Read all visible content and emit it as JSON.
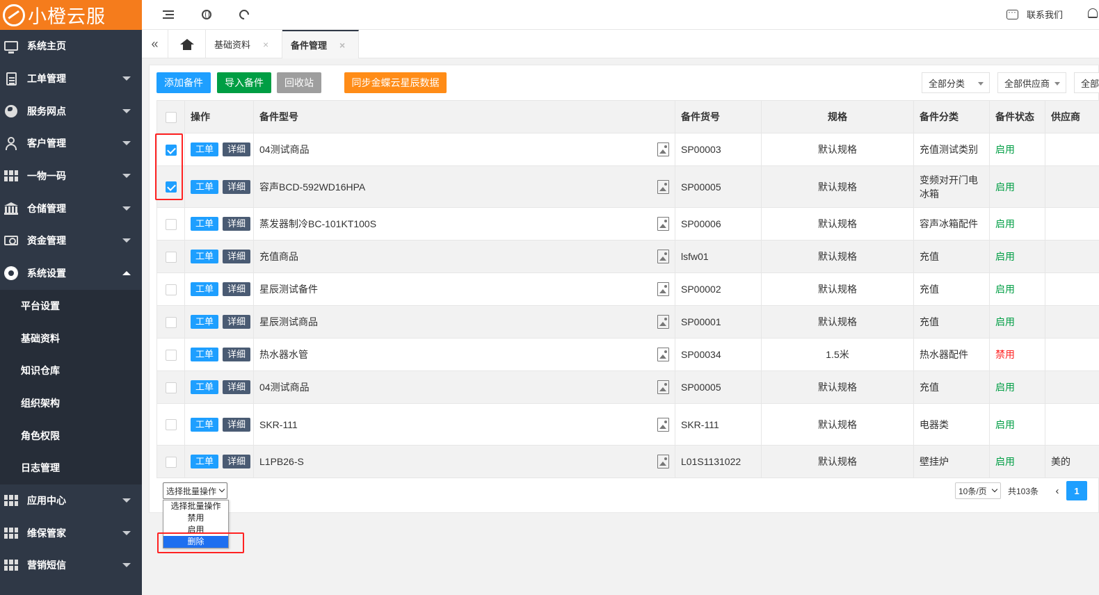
{
  "app": {
    "name": "小橙云服"
  },
  "sidebar": {
    "items": [
      {
        "label": "系统主页",
        "icon": "monitor-icon",
        "has_caret": false
      },
      {
        "label": "工单管理",
        "icon": "document-icon",
        "has_caret": true
      },
      {
        "label": "服务网点",
        "icon": "globe-icon",
        "has_caret": true
      },
      {
        "label": "客户管理",
        "icon": "user-icon",
        "has_caret": true
      },
      {
        "label": "一物一码",
        "icon": "grid-icon",
        "has_caret": true
      },
      {
        "label": "仓储管理",
        "icon": "bank-icon",
        "has_caret": true
      },
      {
        "label": "资金管理",
        "icon": "money-icon",
        "has_caret": true
      },
      {
        "label": "系统设置",
        "icon": "gear-icon",
        "has_caret": true,
        "expanded": true
      }
    ],
    "sub_items": [
      "平台设置",
      "基础资料",
      "知识仓库",
      "组织架构",
      "角色权限",
      "日志管理"
    ],
    "bottom_items": [
      {
        "label": "应用中心",
        "icon": "grid-icon"
      },
      {
        "label": "维保管家",
        "icon": "grid-icon"
      },
      {
        "label": "营销短信",
        "icon": "grid-icon"
      }
    ]
  },
  "topbar": {
    "contact": "联系我们"
  },
  "tabs": [
    {
      "label": "基础资料",
      "close": "×"
    },
    {
      "label": "备件管理",
      "close": "×",
      "active": true
    }
  ],
  "toolbar": {
    "add": "添加备件",
    "import": "导入备件",
    "recycle": "回收站",
    "sync": "同步金蝶云星辰数据",
    "filter_category": "全部分类",
    "filter_supplier": "全部供应商",
    "filter_more": "全部"
  },
  "table": {
    "columns": [
      "操作",
      "备件型号",
      "备件货号",
      "规格",
      "备件分类",
      "备件状态",
      "供应商"
    ],
    "action_wo": "工单",
    "action_detail": "详细",
    "rows": [
      {
        "checked": true,
        "model": "04测试商品",
        "sku": "SP00003",
        "spec": "默认规格",
        "category": "充值测试类别",
        "status": "启用",
        "supplier": ""
      },
      {
        "checked": true,
        "model": "容声BCD-592WD16HPA",
        "sku": "SP00005",
        "spec": "默认规格",
        "category": "变频对开门电冰箱",
        "status": "启用",
        "supplier": ""
      },
      {
        "checked": false,
        "model": "蒸发器制冷BC-101KT100S",
        "sku": "SP00006",
        "spec": "默认规格",
        "category": "容声冰箱配件",
        "status": "启用",
        "supplier": ""
      },
      {
        "checked": false,
        "model": "充值商品",
        "sku": "lsfw01",
        "spec": "默认规格",
        "category": "充值",
        "status": "启用",
        "supplier": ""
      },
      {
        "checked": false,
        "model": "星辰测试备件",
        "sku": "SP00002",
        "spec": "默认规格",
        "category": "充值",
        "status": "启用",
        "supplier": ""
      },
      {
        "checked": false,
        "model": "星辰测试商品",
        "sku": "SP00001",
        "spec": "默认规格",
        "category": "充值",
        "status": "启用",
        "supplier": ""
      },
      {
        "checked": false,
        "model": "热水器水管",
        "sku": "SP00034",
        "spec": "1.5米",
        "category": "热水器配件",
        "status": "禁用",
        "supplier": ""
      },
      {
        "checked": false,
        "model": "04测试商品",
        "sku": "SP00005",
        "spec": "默认规格",
        "category": "充值",
        "status": "启用",
        "supplier": ""
      },
      {
        "checked": false,
        "model": "SKR-111",
        "sku": "SKR-111",
        "spec": "默认规格",
        "category": "电器类",
        "status": "启用",
        "supplier": ""
      },
      {
        "checked": false,
        "model": "L1PB26-S",
        "sku": "L01S1131022",
        "spec": "默认规格",
        "category": "壁挂炉",
        "status": "启用",
        "supplier": "美的"
      }
    ]
  },
  "batch": {
    "selected": "选择批量操作",
    "options": [
      "选择批量操作",
      "禁用",
      "启用",
      "删除"
    ],
    "highlighted": "删除"
  },
  "pager": {
    "page_size": "10条/页",
    "total": "共103条",
    "prev": "‹",
    "current": "1"
  },
  "colors": {
    "accent": "#1e9fff",
    "brand": "#f57c1c",
    "sidebar": "#2f3846",
    "import": "#009e44",
    "sync": "#ff8c17",
    "status_on": "#009e44",
    "status_off": "#ff2222"
  }
}
